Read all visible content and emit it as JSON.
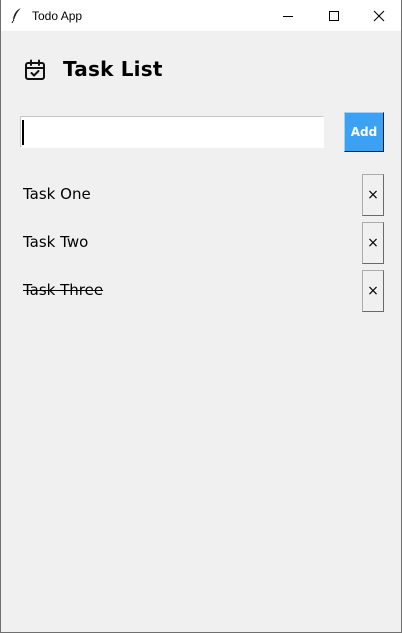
{
  "window": {
    "title": "Todo App",
    "minimize_icon": "minimize-icon",
    "maximize_icon": "maximize-icon",
    "close_icon": "close-icon",
    "app_icon": "feather-icon"
  },
  "header": {
    "icon": "calendar-check-icon",
    "title": "Task List"
  },
  "input": {
    "value": "",
    "placeholder": ""
  },
  "add_button": {
    "label": "Add",
    "color": "#3ba1f5"
  },
  "tasks": [
    {
      "label": "Task One",
      "completed": false,
      "delete_label": "×"
    },
    {
      "label": "Task Two",
      "completed": false,
      "delete_label": "×"
    },
    {
      "label": "Task Three",
      "completed": true,
      "delete_label": "×"
    }
  ]
}
